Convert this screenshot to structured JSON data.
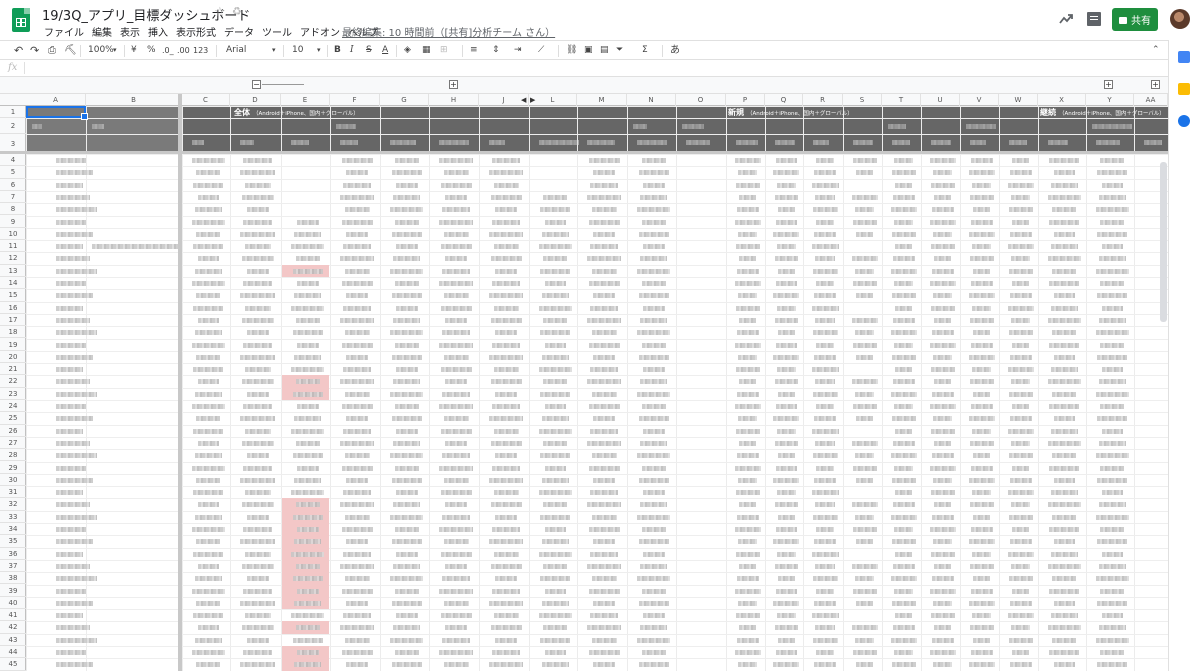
{
  "window": {
    "doc_title": "19/3Q_アプリ_目標ダッシュボード",
    "last_edit": "最終編集: 10 時間前（[共有]分析チーム さん）",
    "share_label": "共有"
  },
  "menu": [
    "ファイル",
    "編集",
    "表示",
    "挿入",
    "表示形式",
    "データ",
    "ツール",
    "アドオン",
    "ヘルプ"
  ],
  "toolbar": {
    "zoom": "100%",
    "currency": "¥",
    "percent": "%",
    "decrease_decimal": ".0_",
    "increase_decimal": ".00",
    "more_formats": "123",
    "font": "Arial",
    "font_size": "10",
    "bold": "B",
    "italic": "I",
    "strikethrough": "S",
    "text_color": "A",
    "sum": "Σ",
    "input_tools": "あ"
  },
  "formula_bar": {
    "fx_label": "fx",
    "value": ""
  },
  "columns": [
    "A",
    "B",
    "C",
    "D",
    "E",
    "F",
    "G",
    "H",
    "J",
    "L",
    "M",
    "N",
    "O",
    "P",
    "Q",
    "R",
    "S",
    "T",
    "U",
    "V",
    "W",
    "X",
    "Y",
    "AA"
  ],
  "rows": [
    "1",
    "2",
    "3",
    "4",
    "5",
    "6",
    "7",
    "8",
    "9",
    "10",
    "11",
    "12",
    "13",
    "14",
    "15",
    "16",
    "17",
    "18",
    "19",
    "20",
    "21",
    "22",
    "23",
    "24",
    "25",
    "26",
    "27",
    "28",
    "29",
    "30",
    "31",
    "32",
    "33",
    "34",
    "35",
    "36",
    "37",
    "38",
    "39",
    "40",
    "41",
    "42",
    "43",
    "44",
    "45"
  ],
  "bands": [
    {
      "title": "全体",
      "subtitle": "（Android＋iPhone、国内＋グローバル）"
    },
    {
      "title": "新規",
      "subtitle": "（Android＋iPhone、国内＋グローバル）"
    },
    {
      "title": "継続",
      "subtitle": "（Android＋iPhone、国内＋グローバル）"
    }
  ],
  "icons": {
    "doc": "sheets-icon",
    "star": "star-icon",
    "drive": "drive-icon",
    "trend": "explore-icon",
    "comment": "comment-icon",
    "lock": "lock-icon",
    "calendar": "calendar-icon",
    "keep": "keep-icon",
    "tasks": "tasks-icon"
  },
  "colors": {
    "band_bg": "#666666",
    "highlight": "#f3c7c7",
    "share": "#1e8e3e",
    "selection": "#1a73e8"
  }
}
